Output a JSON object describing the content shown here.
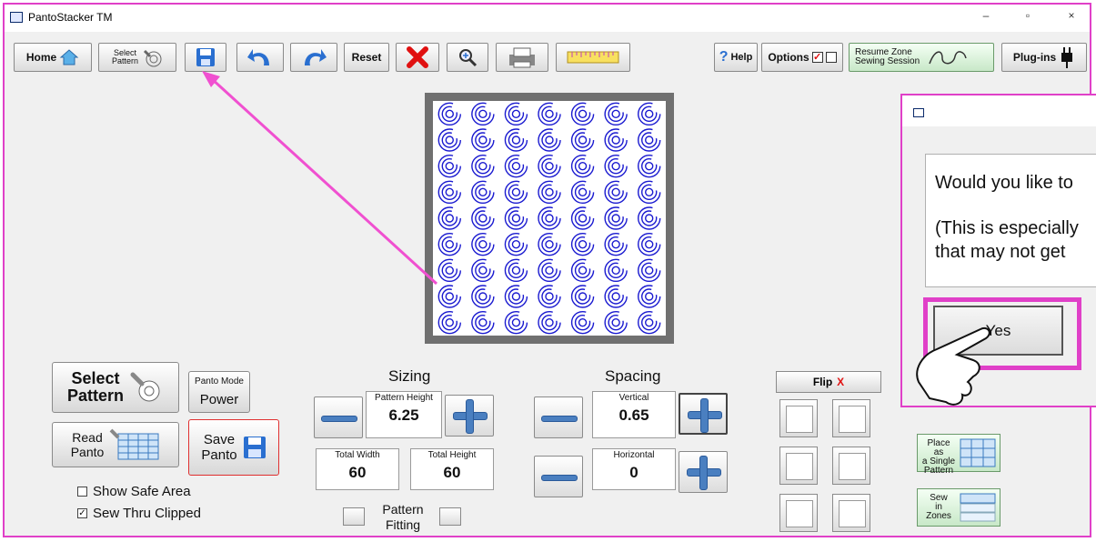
{
  "window": {
    "title": "PantoStacker TM",
    "min": "–",
    "max": "▫",
    "close": "×"
  },
  "toolbar": {
    "home": "Home",
    "select_pattern_line1": "Select",
    "select_pattern_line2": "Pattern",
    "reset": "Reset",
    "help": "Help",
    "options": "Options",
    "resume_line1": "Resume Zone",
    "resume_line2": "Sewing Session",
    "plugins": "Plug-ins"
  },
  "dialog": {
    "line1": "Would you like to",
    "line2": "(This is especially",
    "line3": "that may not get",
    "yes": "Yes"
  },
  "left_panel": {
    "select_line1": "Select",
    "select_line2": "Pattern",
    "panto_mode_label": "Panto Mode",
    "panto_mode_value": "Power",
    "read_line1": "Read",
    "read_line2": "Panto",
    "save_line1": "Save",
    "save_line2": "Panto",
    "show_safe_area": "Show Safe Area",
    "sew_thru_clipped": "Sew Thru Clipped",
    "show_safe_area_checked": false,
    "sew_thru_clipped_checked": true
  },
  "sizing": {
    "title": "Sizing",
    "pattern_height_label": "Pattern Height",
    "pattern_height": "6.25",
    "total_width_label": "Total Width",
    "total_width": "60",
    "total_height_label": "Total Height",
    "total_height": "60",
    "pattern_fitting_line1": "Pattern",
    "pattern_fitting_line2": "Fitting"
  },
  "spacing": {
    "title": "Spacing",
    "vertical_label": "Vertical",
    "vertical": "0.65",
    "horizontal_label": "Horizontal",
    "horizontal": "0"
  },
  "right_panel": {
    "flip": "Flip",
    "flip_x": "X",
    "place_line1": "Place as",
    "place_line2": "a Single",
    "place_line3": "Pattern",
    "sew_line1": "Sew",
    "sew_line2": "in",
    "sew_line3": "Zones"
  },
  "colors": {
    "annotation": "#e040c8",
    "accent": "#4a7fc0",
    "pattern": "#1a1ad0"
  }
}
